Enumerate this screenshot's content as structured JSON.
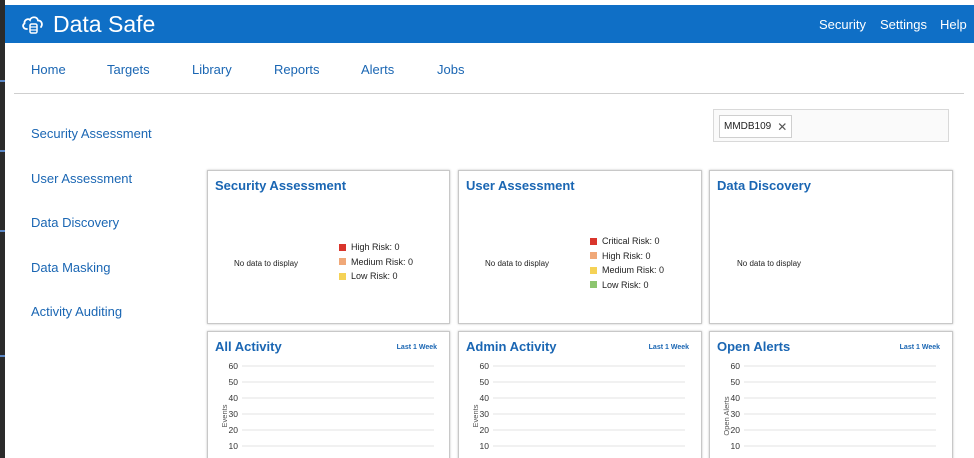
{
  "colors": {
    "brand_bar": "#0f6fc6",
    "link": "#1a66b3",
    "high_risk": "#d9352c",
    "medium_risk": "#f0a878",
    "low_risk": "#f5d256",
    "critical_risk": "#d9352c",
    "user_high_risk": "#f0a878",
    "user_medium_risk": "#f5d256",
    "user_low_risk": "#8cc56e",
    "bar": "#6fb1ec"
  },
  "header": {
    "title": "Data Safe",
    "logo_icon": "cloud-database-icon",
    "links": [
      "Security",
      "Settings",
      "Help"
    ]
  },
  "nav": {
    "items": [
      "Home",
      "Targets",
      "Library",
      "Reports",
      "Alerts",
      "Jobs"
    ]
  },
  "sidebar": {
    "items": [
      "Security Assessment",
      "User Assessment",
      "Data Discovery",
      "Data Masking",
      "Activity Auditing"
    ]
  },
  "filter": {
    "chip": "MMDB109",
    "remove_icon": "close-icon"
  },
  "cards": {
    "security_assessment": {
      "title": "Security Assessment",
      "no_data": "No data to display",
      "legend": [
        "High Risk: 0",
        "Medium Risk: 0",
        "Low Risk: 0"
      ]
    },
    "user_assessment": {
      "title": "User Assessment",
      "no_data": "No data to display",
      "legend": [
        "Critical Risk: 0",
        "High Risk: 0",
        "Medium Risk: 0",
        "Low Risk: 0"
      ]
    },
    "data_discovery": {
      "title": "Data Discovery",
      "no_data": "No data to display"
    },
    "all_activity": {
      "title": "All Activity",
      "range": "Last 1 Week"
    },
    "admin_activity": {
      "title": "Admin Activity",
      "range": "Last 1 Week"
    },
    "open_alerts": {
      "title": "Open Alerts",
      "range": "Last 1 Week"
    }
  },
  "chart_data": [
    {
      "type": "bar",
      "title": "All Activity",
      "ylabel": "Events",
      "yticks": [
        60,
        50,
        40,
        30,
        20,
        10
      ],
      "ylim": [
        0,
        60
      ],
      "grid": true,
      "values": [
        0,
        0,
        0,
        0,
        0,
        0,
        0
      ]
    },
    {
      "type": "bar",
      "title": "Admin Activity",
      "ylabel": "Events",
      "yticks": [
        60,
        50,
        40,
        30,
        20,
        10
      ],
      "ylim": [
        0,
        60
      ],
      "grid": true,
      "values": [
        0,
        0,
        0,
        0,
        0,
        0,
        0
      ]
    },
    {
      "type": "bar",
      "title": "Open Alerts",
      "ylabel": "Open Alerts",
      "yticks": [
        60,
        50,
        40,
        30,
        20,
        10
      ],
      "ylim": [
        0,
        60
      ],
      "grid": true,
      "values": [
        0,
        0,
        0,
        0,
        0,
        0,
        0
      ]
    }
  ]
}
